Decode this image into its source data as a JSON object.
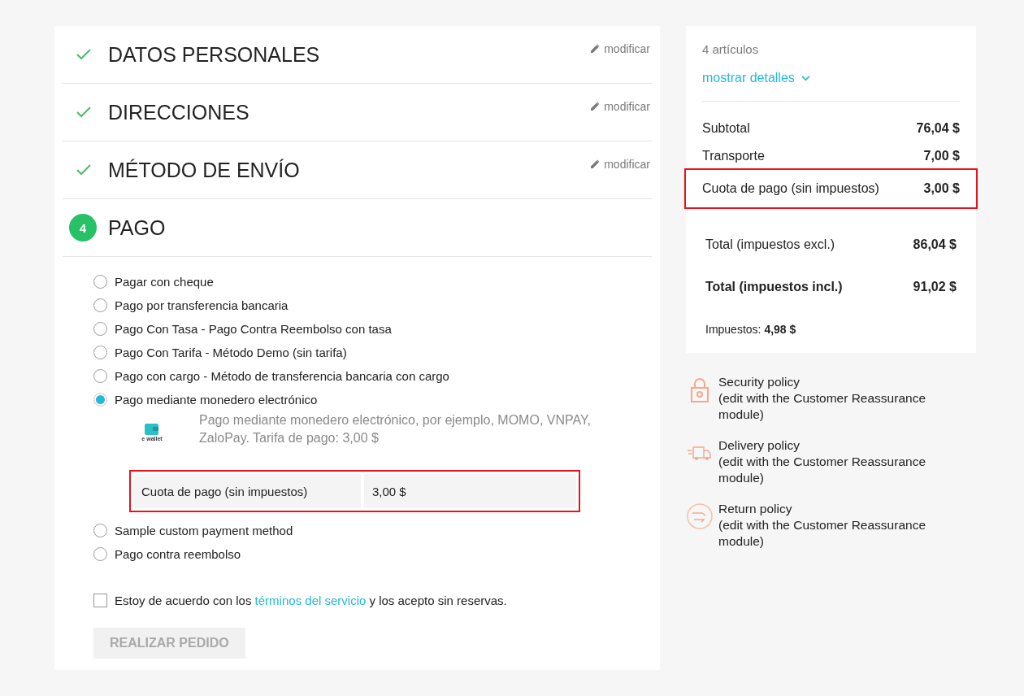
{
  "steps": [
    {
      "title": "DATOS PERSONALES",
      "done": true,
      "edit": "modificar"
    },
    {
      "title": "DIRECCIONES",
      "done": true,
      "edit": "modificar"
    },
    {
      "title": "MÉTODO DE ENVÍO",
      "done": true,
      "edit": "modificar"
    },
    {
      "title": "PAGO",
      "done": false,
      "number": "4"
    }
  ],
  "payment_options": [
    {
      "label": "Pagar con cheque",
      "selected": false
    },
    {
      "label": "Pago por transferencia bancaria",
      "selected": false
    },
    {
      "label": "Pago Con Tasa - Pago Contra Reembolso con tasa",
      "selected": false
    },
    {
      "label": "Pago Con Tarifa - Método Demo (sin tarifa)",
      "selected": false
    },
    {
      "label": "Pago con cargo - Método de transferencia bancaria con cargo",
      "selected": false
    },
    {
      "label": "Pago mediante monedero electrónico",
      "selected": true,
      "details": {
        "logo_text": "e wallet",
        "description": "Pago mediante monedero electrónico, por ejemplo, MOMO, VNPAY, ZaloPay. Tarifa de pago: 3,00 $",
        "fee_label": "Cuota de pago (sin impuestos)",
        "fee_value": "3,00 $",
        "highlighted": true
      }
    },
    {
      "label": "Sample custom payment method",
      "selected": false
    },
    {
      "label": "Pago contra reembolso",
      "selected": false
    }
  ],
  "terms": {
    "before": "Estoy de acuerdo con los ",
    "link": "términos del servicio",
    "after": " y los acepto sin reservas.",
    "checked": false
  },
  "order_button": {
    "label": "REALIZAR PEDIDO",
    "disabled": true
  },
  "summary": {
    "items_count": "4 artículos",
    "details_link": "mostrar detalles",
    "lines": [
      {
        "label": "Subtotal",
        "value": "76,04 $",
        "highlighted": false
      },
      {
        "label": "Transporte",
        "value": "7,00 $",
        "highlighted": false
      },
      {
        "label": "Cuota de pago (sin impuestos)",
        "value": "3,00 $",
        "highlighted": true
      }
    ],
    "totals": [
      {
        "label": "Total (impuestos excl.)",
        "value": "86,04 $",
        "bold": false
      },
      {
        "label": "Total (impuestos incl.)",
        "value": "91,02 $",
        "bold": true
      }
    ],
    "taxes_label": "Impuestos:",
    "taxes_value": "4,98 $"
  },
  "reassurance": [
    {
      "kind": "security",
      "title": "Security policy",
      "text": "(edit with the Customer Reassurance module)"
    },
    {
      "kind": "delivery",
      "title": "Delivery policy",
      "text": "(edit with the Customer Reassurance module)"
    },
    {
      "kind": "return",
      "title": "Return policy",
      "text": "(edit with the Customer Reassurance module)"
    }
  ]
}
